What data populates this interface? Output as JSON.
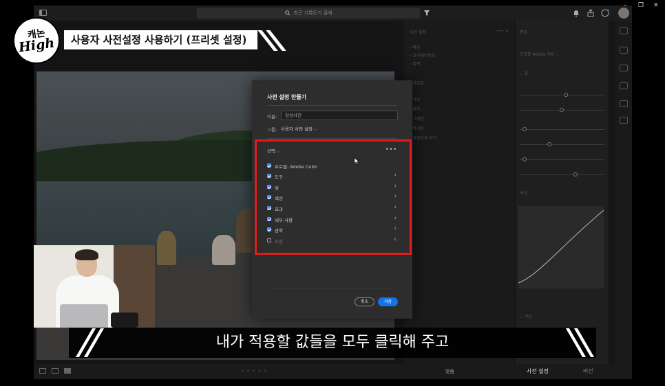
{
  "topbar": {
    "search_placeholder": "최근 기록도기 검색"
  },
  "window_controls": {
    "minimize": "–",
    "restore": "❐",
    "close": "✕"
  },
  "channel": {
    "logo_line1": "캐논",
    "logo_line2": "High",
    "title": "사용자 사전설정 사용하기 (프리셋 설정)"
  },
  "dialog": {
    "title": "사전 설정 만들기",
    "name_label": "이름:",
    "name_value": "감성사진",
    "group_label": "그룹:",
    "group_value": "사용자 사전 설정 ⌵",
    "select_label": "선택 ⌵",
    "more": "•••",
    "options": [
      {
        "label": "프로필: Adobe Color",
        "checked": true,
        "has_chevron": false
      },
      {
        "label": "도구",
        "checked": true,
        "has_chevron": true
      },
      {
        "label": "빛",
        "checked": true,
        "has_chevron": true
      },
      {
        "label": "색상",
        "checked": true,
        "has_chevron": true
      },
      {
        "label": "효과",
        "checked": true,
        "has_chevron": true
      },
      {
        "label": "세부 사항",
        "checked": true,
        "has_chevron": true
      },
      {
        "label": "광학",
        "checked": true,
        "has_chevron": true
      },
      {
        "label": "모양",
        "checked": false,
        "has_chevron": true
      }
    ],
    "cancel_label": "취소",
    "save_label": "저장"
  },
  "bottombar": {
    "fit_label": "맞춤",
    "presets_tab": "사전 설정",
    "version_tab": "버전"
  },
  "subtitle": "내가 적용할 값들을 모두 클릭해 주고",
  "colors": {
    "highlight": "#e21b1b",
    "save_button": "#1473e6",
    "checkbox": "#5a8be0"
  }
}
